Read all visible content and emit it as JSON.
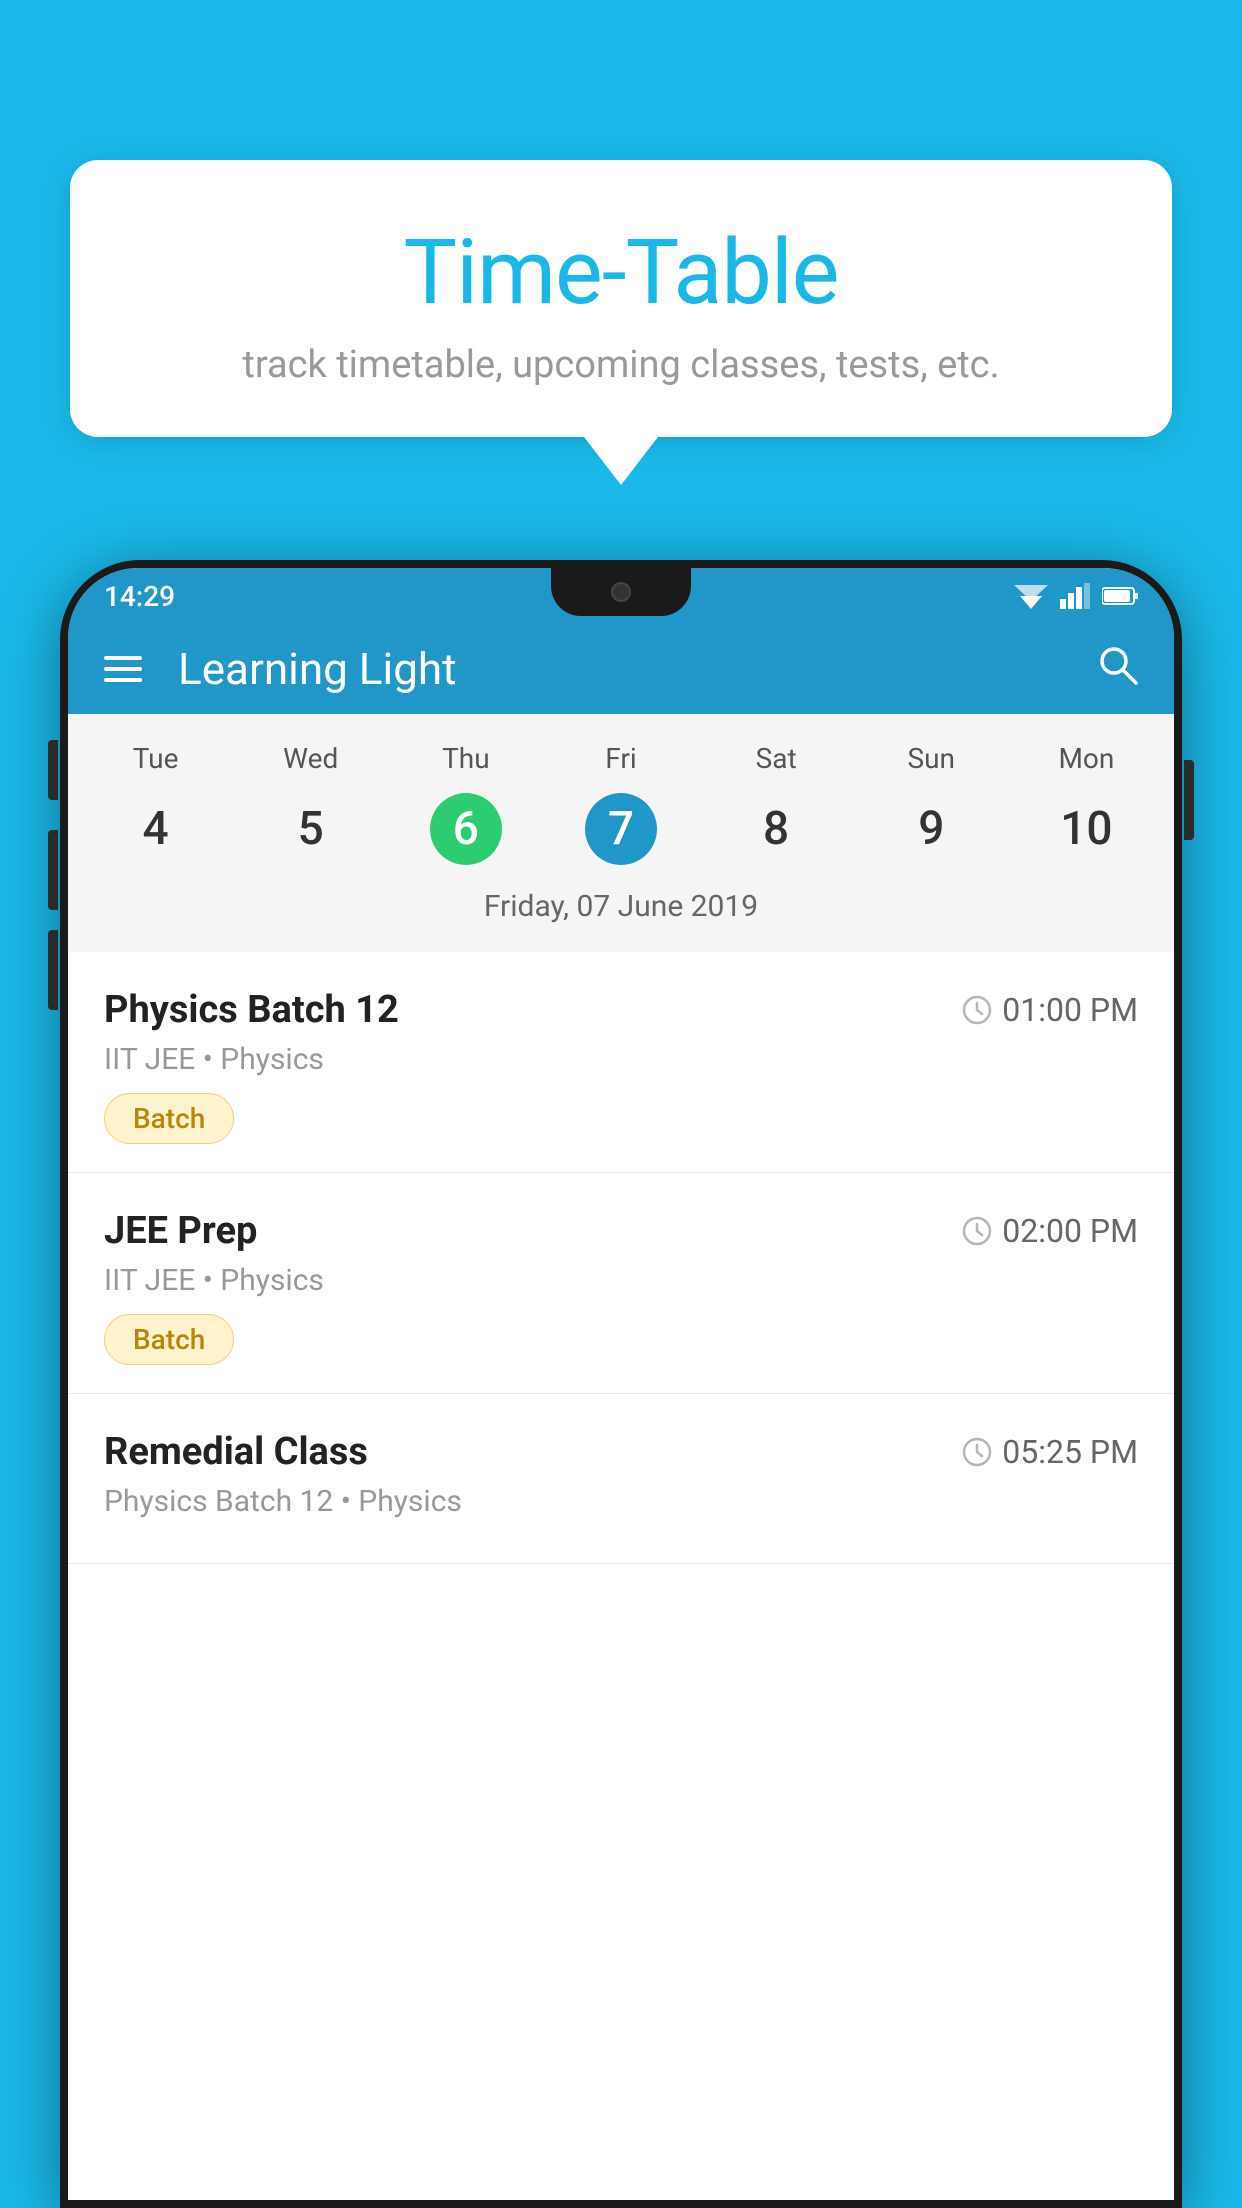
{
  "background_color": "#1ab8e8",
  "tooltip": {
    "title": "Time-Table",
    "subtitle": "track timetable, upcoming classes, tests, etc."
  },
  "status_bar": {
    "time": "14:29"
  },
  "app_bar": {
    "title": "Learning Light",
    "menu_icon": "hamburger-icon",
    "search_icon": "search-icon"
  },
  "calendar": {
    "days": [
      "Tue",
      "Wed",
      "Thu",
      "Fri",
      "Sat",
      "Sun",
      "Mon"
    ],
    "dates": [
      "4",
      "5",
      "6",
      "7",
      "8",
      "9",
      "10"
    ],
    "today_index": 2,
    "selected_index": 3,
    "selected_date_label": "Friday, 07 June 2019"
  },
  "schedule": [
    {
      "title": "Physics Batch 12",
      "time": "01:00 PM",
      "meta": "IIT JEE • Physics",
      "badge": "Batch"
    },
    {
      "title": "JEE Prep",
      "time": "02:00 PM",
      "meta": "IIT JEE • Physics",
      "badge": "Batch"
    },
    {
      "title": "Remedial Class",
      "time": "05:25 PM",
      "meta": "Physics Batch 12 • Physics",
      "badge": null
    }
  ]
}
